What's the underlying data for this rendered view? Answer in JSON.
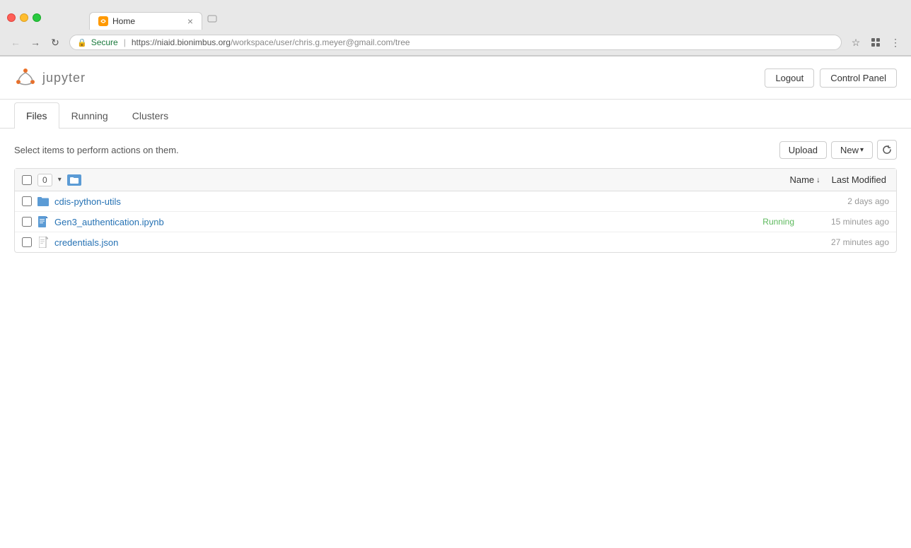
{
  "browser": {
    "traffic_lights": [
      "red",
      "yellow",
      "green"
    ],
    "tab": {
      "title": "Home",
      "favicon": "🏠"
    },
    "address": {
      "secure_label": "Secure",
      "url_display": "https://niaid.bionimbus.org/workspace/user/chris.g.meyer@gmail.com/tree",
      "url_origin": "https://niaid.bionimbus.org",
      "url_path": "/workspace/user/chris.g.meyer@gmail.com/tree"
    }
  },
  "header": {
    "logo_text": "jupyter",
    "buttons": {
      "logout": "Logout",
      "control_panel": "Control Panel"
    }
  },
  "nav": {
    "tabs": [
      {
        "id": "files",
        "label": "Files",
        "active": true
      },
      {
        "id": "running",
        "label": "Running",
        "active": false
      },
      {
        "id": "clusters",
        "label": "Clusters",
        "active": false
      }
    ]
  },
  "toolbar": {
    "instruction": "Select items to perform actions on them.",
    "upload_label": "Upload",
    "new_label": "New",
    "item_count": "0"
  },
  "file_list": {
    "columns": {
      "name_label": "Name",
      "name_arrow": "↓",
      "modified_label": "Last Modified"
    },
    "items": [
      {
        "name": "cdis-python-utils",
        "type": "folder",
        "status": "",
        "modified": "2 days ago"
      },
      {
        "name": "Gen3_authentication.ipynb",
        "type": "notebook",
        "status": "Running",
        "modified": "15 minutes ago"
      },
      {
        "name": "credentials.json",
        "type": "json",
        "status": "",
        "modified": "27 minutes ago"
      }
    ]
  }
}
